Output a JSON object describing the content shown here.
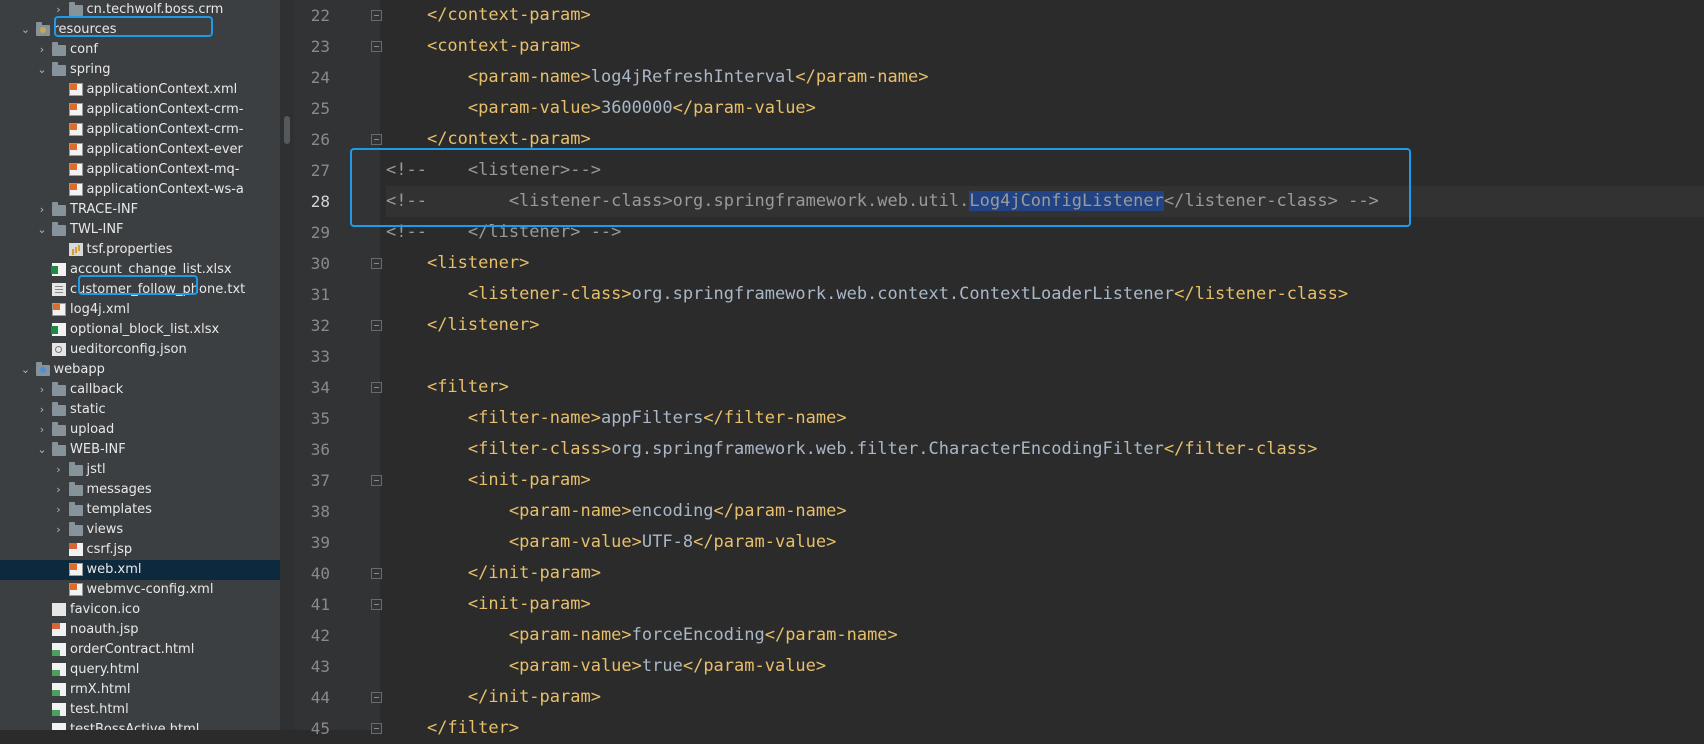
{
  "project_tree": {
    "items": [
      {
        "label": "cn.techwolf.boss.crm",
        "icon": "folder-icon",
        "expanded": false,
        "depth": 5
      },
      {
        "label": "resources",
        "icon": "resources-folder-icon",
        "expanded": true,
        "depth": 3
      },
      {
        "label": "conf",
        "icon": "folder-icon",
        "expanded": false,
        "depth": 4
      },
      {
        "label": "spring",
        "icon": "folder-icon",
        "expanded": true,
        "depth": 4
      },
      {
        "label": "applicationContext.xml",
        "icon": "xml-file-icon",
        "depth": 5
      },
      {
        "label": "applicationContext-crm-",
        "icon": "xml-file-icon",
        "depth": 5
      },
      {
        "label": "applicationContext-crm-",
        "icon": "xml-file-icon",
        "depth": 5
      },
      {
        "label": "applicationContext-ever",
        "icon": "xml-file-icon",
        "depth": 5
      },
      {
        "label": "applicationContext-mq-",
        "icon": "xml-file-icon",
        "depth": 5
      },
      {
        "label": "applicationContext-ws-a",
        "icon": "xml-file-icon",
        "depth": 5
      },
      {
        "label": "TRACE-INF",
        "icon": "folder-icon",
        "expanded": false,
        "depth": 4
      },
      {
        "label": "TWL-INF",
        "icon": "folder-icon",
        "expanded": true,
        "depth": 4
      },
      {
        "label": "tsf.properties",
        "icon": "properties-file-icon",
        "depth": 5
      },
      {
        "label": "account_change_list.xlsx",
        "icon": "excel-file-icon",
        "depth": 4
      },
      {
        "label": "customer_follow_phone.txt",
        "icon": "text-file-icon",
        "depth": 4
      },
      {
        "label": "log4j.xml",
        "icon": "xml-file-icon",
        "depth": 4
      },
      {
        "label": "optional_block_list.xlsx",
        "icon": "excel-file-icon",
        "depth": 4
      },
      {
        "label": "ueditorconfig.json",
        "icon": "json-file-icon",
        "depth": 4
      },
      {
        "label": "webapp",
        "icon": "web-folder-icon",
        "expanded": true,
        "depth": 3
      },
      {
        "label": "callback",
        "icon": "folder-icon",
        "expanded": false,
        "depth": 4
      },
      {
        "label": "static",
        "icon": "folder-icon",
        "expanded": false,
        "depth": 4
      },
      {
        "label": "upload",
        "icon": "folder-icon",
        "expanded": false,
        "depth": 4
      },
      {
        "label": "WEB-INF",
        "icon": "folder-icon",
        "expanded": true,
        "depth": 4
      },
      {
        "label": "jstl",
        "icon": "folder-icon",
        "expanded": false,
        "depth": 5
      },
      {
        "label": "messages",
        "icon": "folder-icon",
        "expanded": false,
        "depth": 5
      },
      {
        "label": "templates",
        "icon": "folder-icon",
        "expanded": false,
        "depth": 5
      },
      {
        "label": "views",
        "icon": "folder-icon",
        "expanded": false,
        "depth": 5
      },
      {
        "label": "csrf.jsp",
        "icon": "jsp-file-icon",
        "depth": 5
      },
      {
        "label": "web.xml",
        "icon": "xml-file-icon",
        "depth": 5,
        "selected": true
      },
      {
        "label": "webmvc-config.xml",
        "icon": "xml-file-icon",
        "depth": 5
      },
      {
        "label": "favicon.ico",
        "icon": "ico-file-icon",
        "depth": 4
      },
      {
        "label": "noauth.jsp",
        "icon": "jsp-file-icon",
        "depth": 4
      },
      {
        "label": "orderContract.html",
        "icon": "html-file-icon",
        "depth": 4
      },
      {
        "label": "query.html",
        "icon": "html-file-icon",
        "depth": 4
      },
      {
        "label": "rmX.html",
        "icon": "html-file-icon",
        "depth": 4
      },
      {
        "label": "test.html",
        "icon": "html-file-icon",
        "depth": 4
      },
      {
        "label": "testBossActive.html",
        "icon": "html-file-icon",
        "depth": 4
      }
    ]
  },
  "editor": {
    "current_line": 28,
    "lines": [
      {
        "num": "22",
        "text": "    </context-param>",
        "kind": "tag",
        "fold": true
      },
      {
        "num": "23",
        "text": "    <context-param>",
        "kind": "tag",
        "fold": true
      },
      {
        "num": "24",
        "text": "        <param-name>log4jRefreshInterval</param-name>",
        "kind": "tag"
      },
      {
        "num": "25",
        "text": "        <param-value>3600000</param-value>",
        "kind": "tag"
      },
      {
        "num": "26",
        "text": "    </context-param>",
        "kind": "tag",
        "fold": true
      },
      {
        "num": "27",
        "text": "<!--    <listener>-->",
        "kind": "comment"
      },
      {
        "num": "28",
        "text": "<!--        <listener-class>org.springframework.web.util.Log4jConfigListener</listener-class> -->",
        "kind": "comment",
        "highlight": "Log4jConfigListener"
      },
      {
        "num": "29",
        "text": "<!--    </listener> -->",
        "kind": "comment"
      },
      {
        "num": "30",
        "text": "    <listener>",
        "kind": "tag",
        "fold": true
      },
      {
        "num": "31",
        "text": "        <listener-class>org.springframework.web.context.ContextLoaderListener</listener-class>",
        "kind": "tag"
      },
      {
        "num": "32",
        "text": "    </listener>",
        "kind": "tag",
        "fold": true
      },
      {
        "num": "33",
        "text": "",
        "kind": "tag"
      },
      {
        "num": "34",
        "text": "    <filter>",
        "kind": "tag",
        "fold": true
      },
      {
        "num": "35",
        "text": "        <filter-name>appFilters</filter-name>",
        "kind": "tag"
      },
      {
        "num": "36",
        "text": "        <filter-class>org.springframework.web.filter.CharacterEncodingFilter</filter-class>",
        "kind": "tag"
      },
      {
        "num": "37",
        "text": "        <init-param>",
        "kind": "tag",
        "fold": true
      },
      {
        "num": "38",
        "text": "            <param-name>encoding</param-name>",
        "kind": "tag"
      },
      {
        "num": "39",
        "text": "            <param-value>UTF-8</param-value>",
        "kind": "tag"
      },
      {
        "num": "40",
        "text": "        </init-param>",
        "kind": "tag",
        "fold": true
      },
      {
        "num": "41",
        "text": "        <init-param>",
        "kind": "tag",
        "fold": true
      },
      {
        "num": "42",
        "text": "            <param-name>forceEncoding</param-name>",
        "kind": "tag"
      },
      {
        "num": "43",
        "text": "            <param-value>true</param-value>",
        "kind": "tag"
      },
      {
        "num": "44",
        "text": "        </init-param>",
        "kind": "tag",
        "fold": true
      },
      {
        "num": "45",
        "text": "    </filter>",
        "kind": "tag",
        "fold": true
      }
    ]
  },
  "colors": {
    "editor_bg": "#2b2b2b",
    "sidebar_bg": "#3c3f41",
    "xml_tag": "#e8bf6a",
    "text": "#a9b7c6",
    "comment": "#9a9a9a",
    "selection": "#214283",
    "callout_outline": "#1e9be6"
  }
}
